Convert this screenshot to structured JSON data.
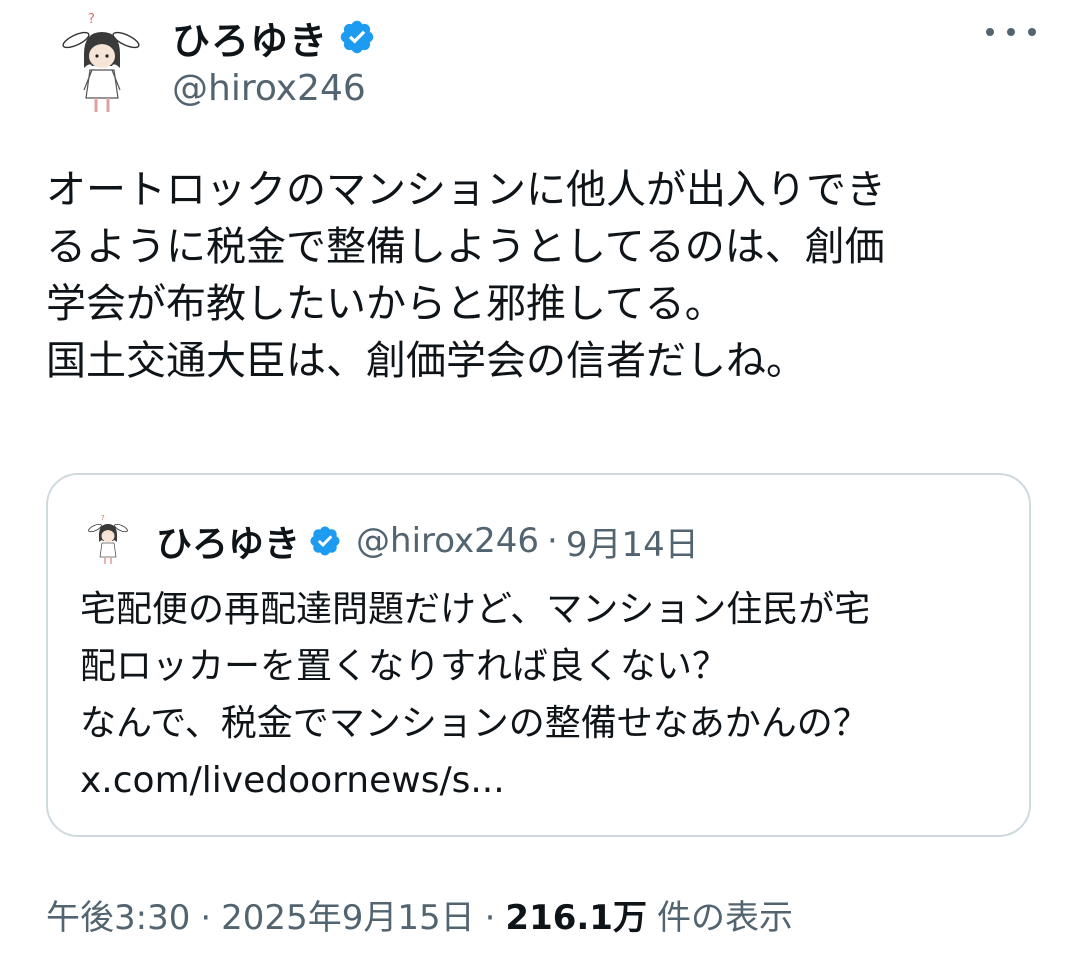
{
  "author": {
    "display_name": "ひろゆき",
    "handle": "@hirox246",
    "verified": true,
    "avatar_icon": "bunny-ear-character-avatar"
  },
  "more_icon": "more-options-icon",
  "body_lines": [
    "オートロックのマンションに他人が出入りでき",
    "るように税金で整備しようとしてるのは、創価",
    "学会が布教したいからと邪推してる。",
    "国土交通大臣は、創価学会の信者だしね。"
  ],
  "quote": {
    "display_name": "ひろゆき",
    "handle": "@hirox246",
    "separator": "·",
    "date": "9月14日",
    "lines": [
      "宅配便の再配達問題だけど、マンション住民が宅",
      "配ロッカーを置くなりすれば良くない？",
      "なんで、税金でマンションの整備せなあかんの？"
    ],
    "link": "x.com/livedoornews/s..."
  },
  "meta": {
    "time": "午後3:30",
    "separator": "·",
    "date": "2025年9月15日",
    "views": "216.1万",
    "views_label": "件の表示"
  },
  "colors": {
    "text": "#0f1419",
    "secondary": "#536471",
    "verified": "#1d9bf0",
    "border": "#cfd9de"
  }
}
